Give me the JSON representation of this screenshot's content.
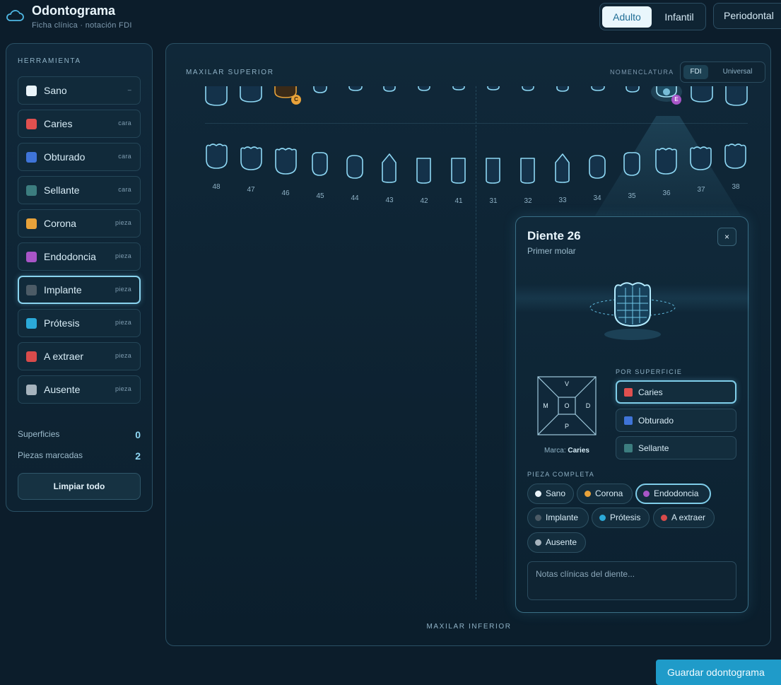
{
  "header": {
    "icon": "cloud-icon",
    "title": "Odontograma",
    "subtitle": "Ficha clínica · notación FDI",
    "modes": [
      {
        "label": "Adulto",
        "active": true
      },
      {
        "label": "Infantil",
        "active": false
      }
    ],
    "periodontal_label": "Periodontal"
  },
  "tools": {
    "title": "HERRAMIENTA",
    "items": [
      {
        "label": "Sano",
        "scope": "–",
        "color": "#eaf4fa",
        "active": false
      },
      {
        "label": "Caries",
        "scope": "cara",
        "color": "#e0504f",
        "active": false
      },
      {
        "label": "Obturado",
        "scope": "cara",
        "color": "#3f74d8",
        "active": false
      },
      {
        "label": "Sellante",
        "scope": "cara",
        "color": "#3c7d7f",
        "active": false
      },
      {
        "label": "Corona",
        "scope": "pieza",
        "color": "#e8a23a",
        "active": false
      },
      {
        "label": "Endodoncia",
        "scope": "pieza",
        "color": "#a855c7",
        "active": false
      },
      {
        "label": "Implante",
        "scope": "pieza",
        "color": "#4c5b66",
        "active": true
      },
      {
        "label": "Prótesis",
        "scope": "pieza",
        "color": "#2ba9d8",
        "active": false
      },
      {
        "label": "A extraer",
        "scope": "pieza",
        "color": "#d94b4b",
        "active": false
      },
      {
        "label": "Ausente",
        "scope": "pieza",
        "color": "#a6b3bd",
        "active": false
      }
    ],
    "stats": [
      {
        "label": "Superficies",
        "value": "0"
      },
      {
        "label": "Piezas marcadas",
        "value": "2"
      }
    ],
    "clear_label": "Limpiar todo"
  },
  "chart": {
    "upper_label": "MAXILAR SUPERIOR",
    "lower_label": "MAXILAR INFERIOR",
    "nomenclature_label": "NOMENCLATURA",
    "nomenclature_options": [
      {
        "label": "FDI",
        "active": true
      },
      {
        "label": "Universal",
        "active": false
      }
    ],
    "upper_marks": [
      {
        "label": "C",
        "color": "#e8a23a"
      },
      {
        "label": "E",
        "color": "#a855c7"
      }
    ],
    "lower_teeth": [
      "48",
      "47",
      "46",
      "45",
      "44",
      "43",
      "42",
      "41",
      "31",
      "32",
      "33",
      "34",
      "35",
      "36",
      "37",
      "38"
    ]
  },
  "panel": {
    "title": "Diente 26",
    "subtitle": "Primer molar",
    "close_label": "×",
    "surface_letters": {
      "top": "V",
      "left": "M",
      "center": "O",
      "right": "D",
      "bottom": "P"
    },
    "marca_prefix": "Marca:",
    "marca_value": "Caries",
    "por_superficie_label": "POR SUPERFICIE",
    "surface_options": [
      {
        "label": "Caries",
        "color": "#e0504f",
        "active": true
      },
      {
        "label": "Obturado",
        "color": "#3f74d8",
        "active": false
      },
      {
        "label": "Sellante",
        "color": "#3c7d7f",
        "active": false
      }
    ],
    "pieza_completa_label": "PIEZA COMPLETA",
    "piece_options": [
      {
        "label": "Sano",
        "color": "#eaf4fa",
        "active": false
      },
      {
        "label": "Corona",
        "color": "#e8a23a",
        "active": false
      },
      {
        "label": "Endodoncia",
        "color": "#a855c7",
        "active": true
      },
      {
        "label": "Implante",
        "color": "#4c5b66",
        "active": false
      },
      {
        "label": "Prótesis",
        "color": "#2ba9d8",
        "active": false
      },
      {
        "label": "A extraer",
        "color": "#d94b4b",
        "active": false
      },
      {
        "label": "Ausente",
        "color": "#a6b3bd",
        "active": false
      }
    ],
    "notes_placeholder": "Notas clínicas del diente..."
  },
  "footer": {
    "save_label": "Guardar odontograma"
  }
}
